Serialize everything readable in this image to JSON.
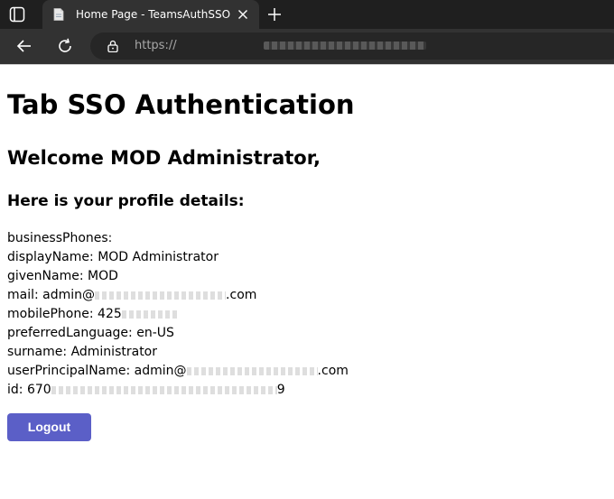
{
  "browser": {
    "tab_title": "Home Page - TeamsAuthSSO",
    "url_visible": "https://"
  },
  "page": {
    "heading": "Tab SSO Authentication",
    "welcome": "Welcome MOD Administrator,",
    "subheading": "Here is your profile details:",
    "profile": [
      {
        "key": "businessPhones:",
        "value": ""
      },
      {
        "key": "displayName:",
        "value": "MOD Administrator"
      },
      {
        "key": "givenName:",
        "value": "MOD"
      },
      {
        "key": "mail:",
        "value": "admin@",
        "value_end": ".com"
      },
      {
        "key": "mobilePhone:",
        "value": "425"
      },
      {
        "key": "preferredLanguage:",
        "value": "en-US"
      },
      {
        "key": "surname:",
        "value": "Administrator"
      },
      {
        "key": "userPrincipalName:",
        "value": "admin@",
        "value_end": ".com"
      },
      {
        "key": "id:",
        "value": "670",
        "value_end": "9"
      }
    ],
    "logout_label": "Logout"
  },
  "colors": {
    "accent": "#5b5fc7",
    "tabbar": "#1f1f1f",
    "toolbar": "#323232"
  }
}
